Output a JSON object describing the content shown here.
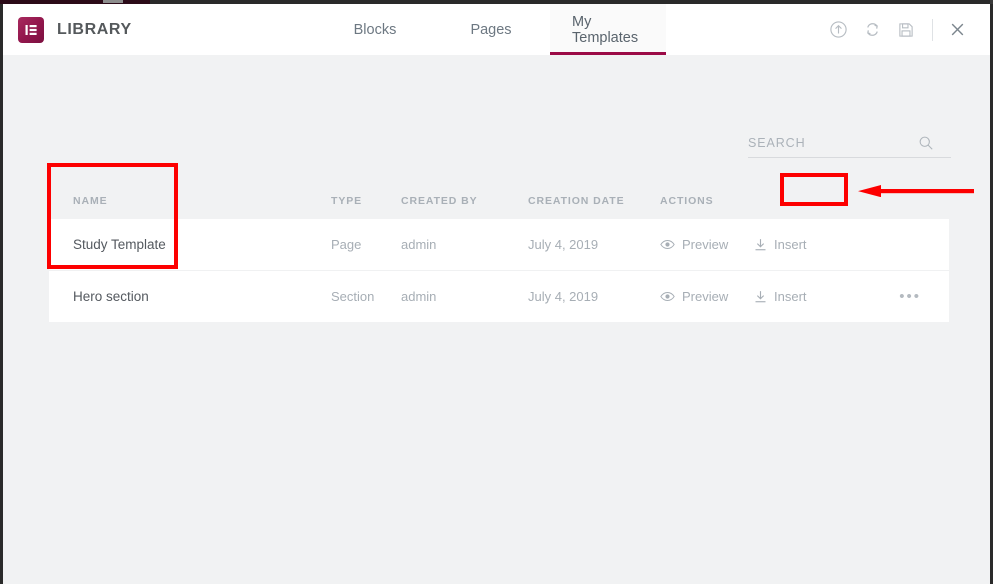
{
  "app": {
    "title": "LIBRARY",
    "logo_icon": "elementor-logo-icon",
    "brand_color": "#93174d"
  },
  "tabs": [
    {
      "label": "Blocks",
      "name": "tab-blocks",
      "active": false
    },
    {
      "label": "Pages",
      "name": "tab-pages",
      "active": false
    },
    {
      "label": "My Templates",
      "name": "tab-my-templates",
      "active": true
    }
  ],
  "header_actions": [
    {
      "name": "import-template-icon",
      "icon": "upload-circle-icon"
    },
    {
      "name": "sync-library-icon",
      "icon": "sync-icon"
    },
    {
      "name": "save-template-icon",
      "icon": "floppy-disk-icon"
    },
    {
      "name": "close-library-icon",
      "icon": "close-icon"
    }
  ],
  "search": {
    "placeholder": "SEARCH",
    "value": "",
    "icon": "search-icon"
  },
  "table": {
    "headers": {
      "name": "NAME",
      "type": "TYPE",
      "created_by": "CREATED BY",
      "creation_date": "CREATION DATE",
      "actions": "ACTIONS"
    },
    "rows": [
      {
        "name": "Study Template",
        "type": "Page",
        "created_by": "admin",
        "creation_date": "July 4, 2019",
        "preview_label": "Preview",
        "insert_label": "Insert",
        "has_more": false
      },
      {
        "name": "Hero section",
        "type": "Section",
        "created_by": "admin",
        "creation_date": "July 4, 2019",
        "preview_label": "Preview",
        "insert_label": "Insert",
        "has_more": true,
        "more_label": "•••"
      }
    ]
  },
  "annotations": {
    "color": "#fd0000",
    "highlight_names_box": "name-column-highlight",
    "highlight_insert_box": "insert-button-highlight",
    "arrow": "pointer-arrow-to-insert"
  }
}
